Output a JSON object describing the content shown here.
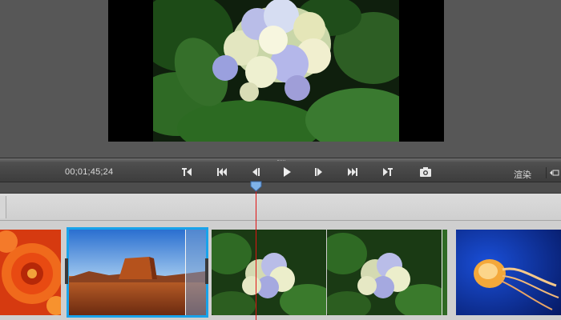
{
  "transport": {
    "timecode": "00;01;45;24",
    "render_label": "渲染",
    "buttons": [
      {
        "name": "go-to-previous-edit-button",
        "icon": "mark-in-icon"
      },
      {
        "name": "go-to-start-button",
        "icon": "skip-back-icon"
      },
      {
        "name": "step-back-button",
        "icon": "step-back-icon"
      },
      {
        "name": "play-button",
        "icon": "play-icon"
      },
      {
        "name": "step-forward-button",
        "icon": "step-forward-icon"
      },
      {
        "name": "go-to-end-button",
        "icon": "skip-forward-icon"
      },
      {
        "name": "go-to-next-edit-button",
        "icon": "mark-out-icon"
      },
      {
        "name": "snapshot-button",
        "icon": "camera-icon"
      }
    ]
  },
  "clips": [
    {
      "name": "clip-red-flower",
      "subject": "red-chrysanthemum",
      "selected": false
    },
    {
      "name": "clip-desert-butte",
      "subject": "desert-mesa",
      "selected": true
    },
    {
      "name": "clip-hydrangea-1",
      "subject": "hydrangea",
      "selected": false
    },
    {
      "name": "clip-hydrangea-2",
      "subject": "hydrangea",
      "selected": false
    },
    {
      "name": "clip-jellyfish",
      "subject": "jellyfish",
      "selected": false
    }
  ],
  "colors": {
    "selection": "#19a3ea",
    "playhead": "#e01414",
    "playhead_knob": "#7fb2e8"
  }
}
